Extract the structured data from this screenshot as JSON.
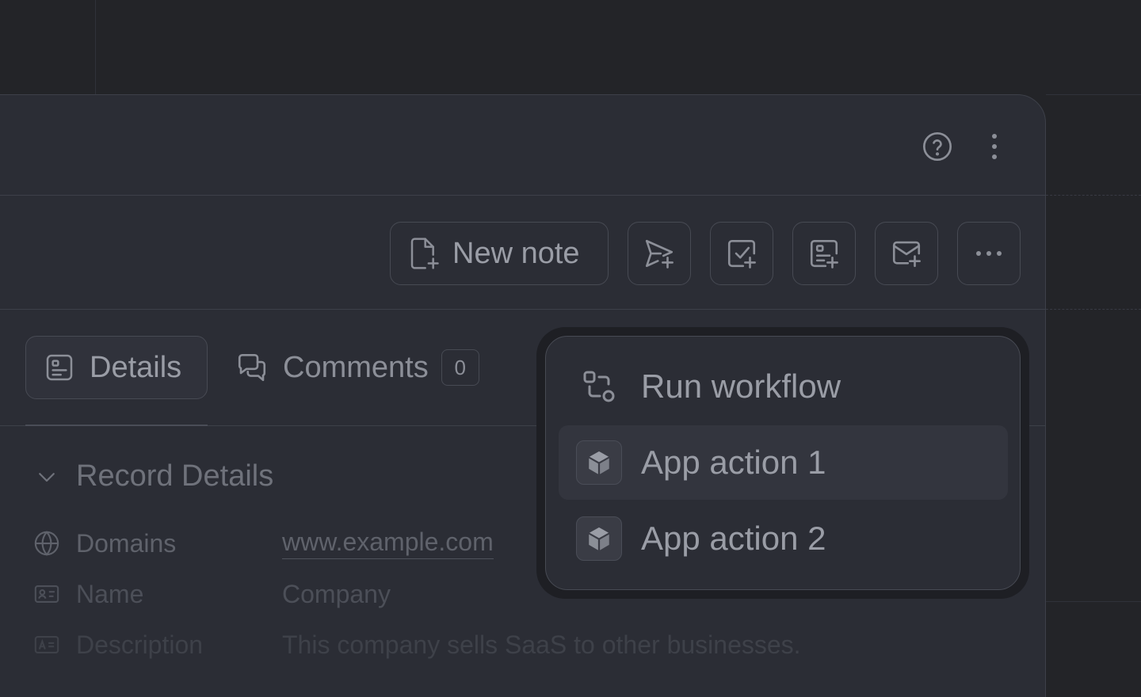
{
  "header": {
    "help_icon": "help-circle-icon",
    "more_icon": "more-vertical-icon"
  },
  "actions": {
    "new_note_label": "New note",
    "send_icon": "send-plus-icon",
    "task_icon": "task-plus-icon",
    "form_icon": "form-plus-icon",
    "mail_icon": "mail-plus-icon",
    "more_icon": "more-horizontal-icon"
  },
  "tabs": {
    "details_label": "Details",
    "comments_label": "Comments",
    "comments_count": "0"
  },
  "record": {
    "section_title": "Record Details",
    "fields": [
      {
        "key": "Domains",
        "value": "www.example.com",
        "icon": "globe-icon"
      },
      {
        "key": "Name",
        "value": "Company",
        "icon": "id-card-icon"
      },
      {
        "key": "Description",
        "value": "This company sells SaaS to other businesses.",
        "icon": "text-box-icon"
      }
    ]
  },
  "menu": {
    "items": [
      {
        "label": "Run workflow",
        "icon": "workflow-icon"
      },
      {
        "label": "App action 1",
        "icon": "cube-icon"
      },
      {
        "label": "App action 2",
        "icon": "cube-icon"
      }
    ]
  },
  "colors": {
    "background": "#232428",
    "panel": "#2b2d35",
    "border": "#474a53",
    "text": "#9a9da6",
    "menu_hover": "#33353e"
  }
}
